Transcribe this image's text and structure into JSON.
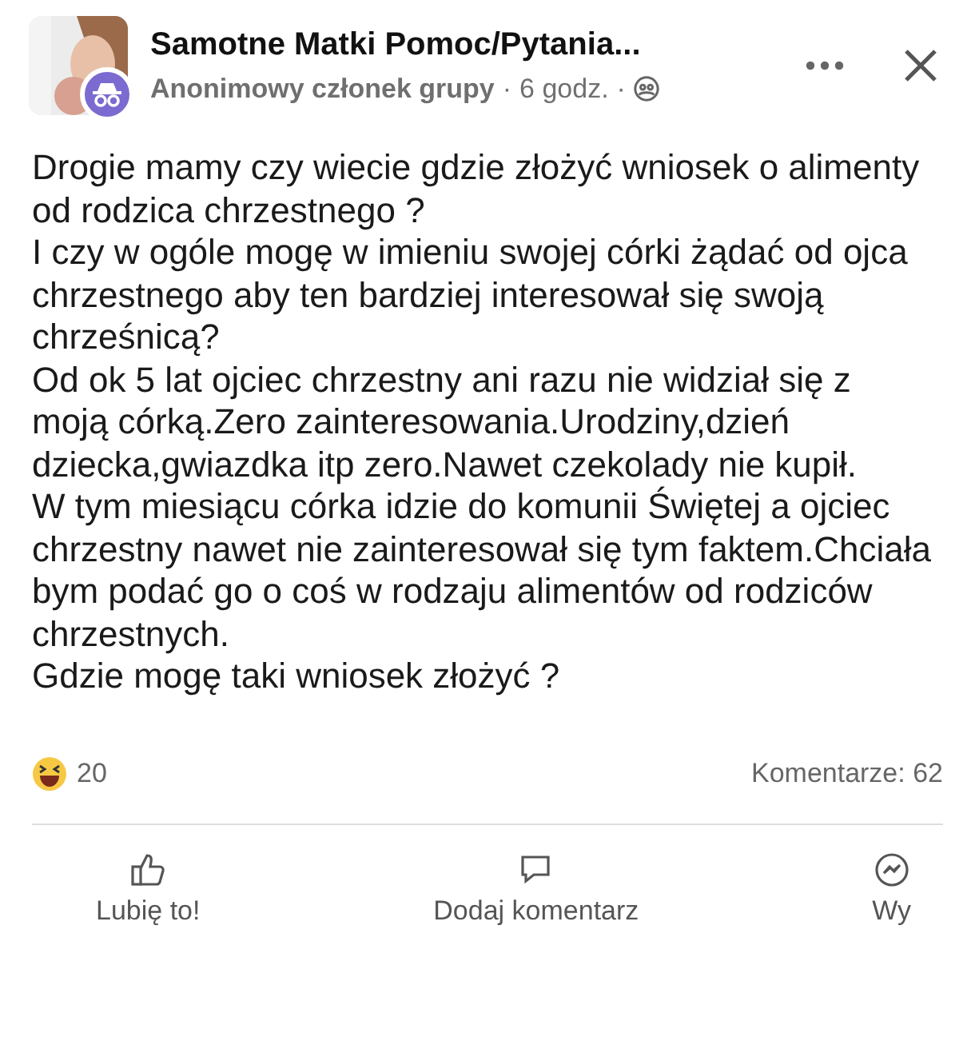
{
  "header": {
    "group_name": "Samotne Matki Pomoc/Pytania...",
    "author": "Anonimowy członek grupy",
    "separator_1": "·",
    "time": "6 godz.",
    "separator_2": "·"
  },
  "post": {
    "paragraphs": [
      "Drogie mamy czy wiecie gdzie złożyć wniosek o alimenty od rodzica chrzestnego ?",
      "I czy w ogóle mogę w imieniu swojej córki żądać od ojca chrzestnego  aby ten bardziej interesował się swoją chrześnicą?",
      "Od ok 5 lat ojciec chrzestny ani razu nie widział się z moją córką.Zero zainteresowania.Urodziny,dzień dziecka,gwiazdka itp zero.Nawet czekolady nie kupił.",
      "W tym miesiącu córka idzie do komunii Świętej a ojciec chrzestny nawet nie zainteresował się tym faktem.Chciała bym podać go o coś w rodzaju alimentów od rodziców chrzestnych.",
      "Gdzie mogę taki wniosek złożyć ?"
    ]
  },
  "stats": {
    "reactions": "20",
    "comments": "Komentarze: 62"
  },
  "actions": [
    {
      "kind": "like",
      "label": "Lubię to!"
    },
    {
      "kind": "comment",
      "label": "Dodaj komentarz"
    },
    {
      "kind": "send",
      "label": "Wy"
    }
  ]
}
